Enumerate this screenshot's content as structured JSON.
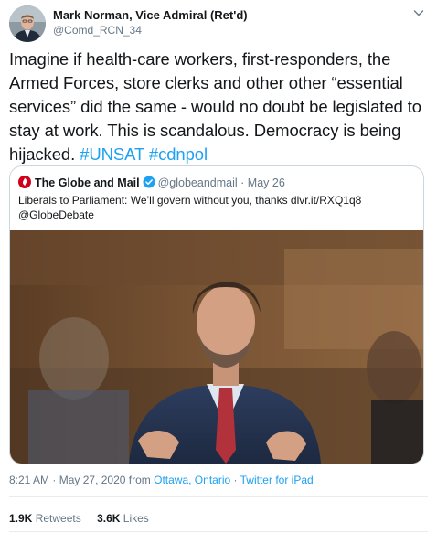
{
  "author": {
    "display_name": "Mark Norman, Vice Admiral (Ret'd)",
    "handle": "@Comd_RCN_34",
    "avatar_icon": "profile-photo"
  },
  "tweet": {
    "text": "Imagine if health-care workers, first-responders, the Armed Forces, store clerks and other other “essential services” did the same - would no doubt be legislated to stay at work. This is scandalous. Democracy is being hijacked.",
    "hashtags": [
      "#UNSAT",
      "#cdnpol"
    ]
  },
  "quoted_tweet": {
    "name": "The Globe and Mail",
    "handle": "@globeandmail",
    "separator": "·",
    "date": "May 26",
    "text": "Liberals to Parliament: We’ll govern without you, thanks dlvr.it/RXQ1q8 @GlobeDebate",
    "photo_icon": "news-photo",
    "brand_color": "#d0021b"
  },
  "meta": {
    "time": "8:21 AM",
    "date": "May 27, 2020",
    "from_label": "from",
    "location": "Ottawa, Ontario",
    "source": "Twitter for iPad",
    "separator": "·"
  },
  "stats": {
    "retweets_count": "1.9K",
    "retweets_label": "Retweets",
    "likes_count": "3.6K",
    "likes_label": "Likes"
  },
  "colors": {
    "link": "#1da1f2",
    "secondary_text": "#657786",
    "border": "#ccd6dd"
  }
}
